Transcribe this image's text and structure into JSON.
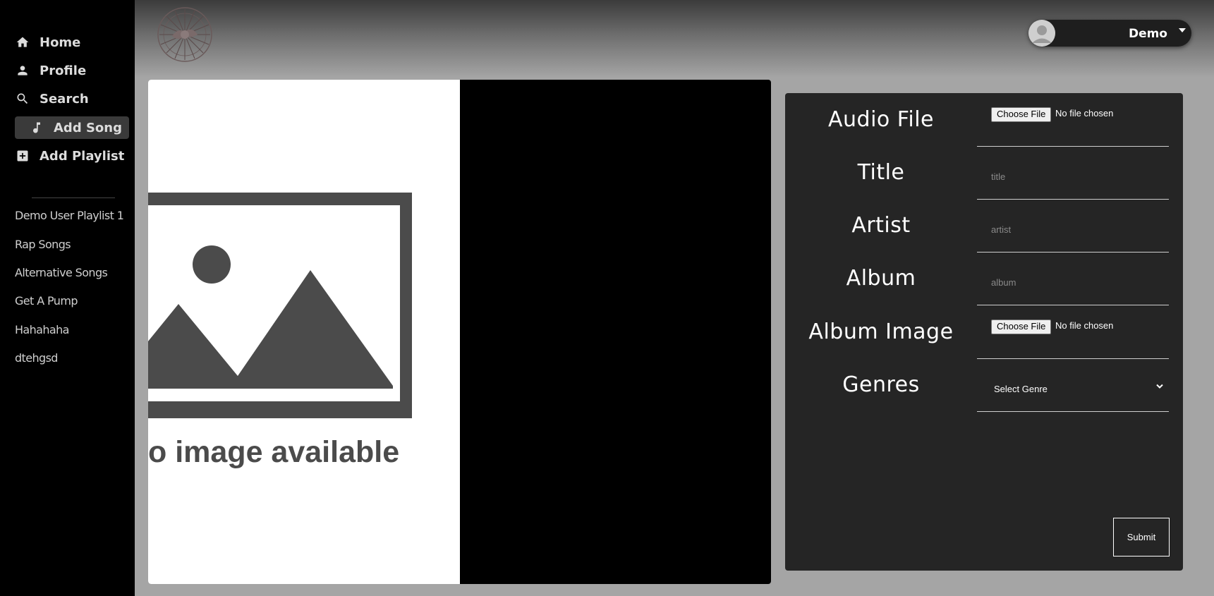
{
  "sidebar": {
    "nav": [
      {
        "label": "Home",
        "icon": "home-icon"
      },
      {
        "label": "Profile",
        "icon": "person-icon"
      },
      {
        "label": "Search",
        "icon": "search-icon"
      },
      {
        "label": "Add Song",
        "icon": "music-note-icon"
      },
      {
        "label": "Add Playlist",
        "icon": "add-box-icon"
      }
    ],
    "playlists": [
      "Demo User Playlist 1",
      "Rap Songs",
      "Alternative Songs",
      "Get A Pump",
      "Hahahaha",
      "dtehgsd"
    ]
  },
  "header": {
    "user_name": "Demo"
  },
  "preview": {
    "placeholder_text": "o image available"
  },
  "form": {
    "audio_file": {
      "label": "Audio File",
      "button": "Choose File",
      "status": "No file chosen"
    },
    "title": {
      "label": "Title",
      "placeholder": "title"
    },
    "artist": {
      "label": "Artist",
      "placeholder": "artist"
    },
    "album": {
      "label": "Album",
      "placeholder": "album"
    },
    "album_image": {
      "label": "Album Image",
      "button": "Choose File",
      "status": "No file chosen"
    },
    "genres": {
      "label": "Genres",
      "selected": "Select Genre"
    },
    "submit": "Submit"
  },
  "colors": {
    "sidebar_bg": "#000000",
    "panel_bg": "#252525",
    "active_nav_bg": "#3a3a3a"
  }
}
